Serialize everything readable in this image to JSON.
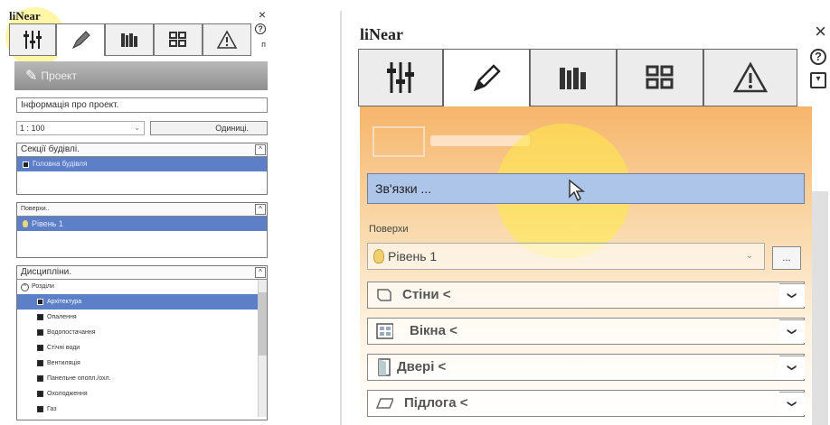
{
  "left_panel": {
    "title": "liNear",
    "close": "×",
    "help": "?",
    "help_suffix": "п",
    "banner_label": "Проект",
    "project_info_placeholder": "Інформація про проект.",
    "scale_value": "1 : 100",
    "units_button": "Одиниці.",
    "buildings_header": "Секції будівлі.",
    "buildings_selected": "Головна будівля",
    "floors_header": "Поверхи..",
    "floors_selected": "Рівень 1",
    "disciplines_header": "Дисципліни.",
    "disciplines_root": "Розділи",
    "disciplines": [
      "Архітектура",
      "Опалення",
      "Водопостачання",
      "Стічні води",
      "Вентиляція",
      "Панельне опопл./охл.",
      "Охолодження",
      "Газ"
    ]
  },
  "right_panel": {
    "title": "liNear",
    "close": "×",
    "help": "?",
    "menu": "▾",
    "links_field": "Зв'язки ...",
    "surfaces_label": "Поверхи",
    "level_value": "Рівень 1",
    "dots_button": "...",
    "categories": [
      {
        "label": "Стіни <",
        "icon": "wall-icon"
      },
      {
        "label": "Вікна <",
        "icon": "window-icon"
      },
      {
        "label": "Двері <",
        "icon": "door-icon"
      },
      {
        "label": "Підлога <",
        "icon": "floor-icon"
      }
    ]
  }
}
